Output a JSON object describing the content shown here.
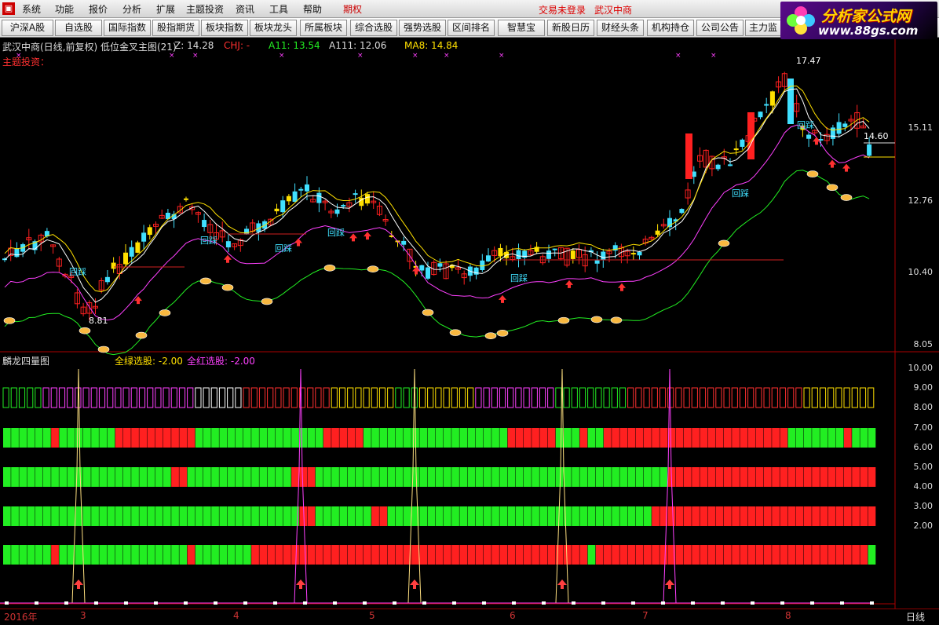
{
  "menu": {
    "items": [
      "系统",
      "功能",
      "报价",
      "分析",
      "扩展",
      "主题投资",
      "资讯",
      "工具",
      "帮助"
    ],
    "highlight": "期权",
    "status_login": "交易未登录",
    "status_stock": "武汉中商"
  },
  "toolbar": {
    "buttons": [
      "沪深A股",
      "自选股",
      "国际指数",
      "股指期货",
      "板块指数",
      "板块龙头",
      "所属板块",
      "综合选股",
      "强势选股",
      "区间排名",
      "智慧宝",
      "新股日历",
      "财经头条",
      "机构持仓",
      "公司公告",
      "主力监控"
    ]
  },
  "brand": {
    "title": "分析家公式网",
    "url": "www.88gs.com"
  },
  "main_chart": {
    "title": "武汉中商(日线,前复权) 低位金叉主图(21)",
    "z_label": "Z: 14.28",
    "chj_label": "CHJ: -",
    "a11_label": "A11: 13.54",
    "a111_label": "A111: 12.06",
    "ma8_label": "MA8: 14.84",
    "subtitle": "主题投资：",
    "price_axis": [
      "15.11",
      "12.76",
      "10.40",
      "8.05"
    ],
    "high_marker": "17.47",
    "low_marker": "8.81",
    "last_price_marker": "14.60",
    "annotation": "回踩"
  },
  "sub_chart": {
    "title": "麟龙四量图",
    "green_label": "全绿选股: -2.00",
    "red_label": "全红选股: -2.00",
    "axis": [
      "10.00",
      "9.00",
      "8.00",
      "7.00",
      "6.00",
      "5.00",
      "4.00",
      "3.00",
      "2.00"
    ]
  },
  "bottom": {
    "year": "2016年",
    "months": [
      "3",
      "4",
      "5",
      "6",
      "7",
      "8"
    ],
    "period": "日线"
  },
  "colors": {
    "up": "#ff2020",
    "down": "#40e0ff",
    "yellow": "#ffe000",
    "green": "#22ee22",
    "magenta": "#ff40ff",
    "white": "#ffffff"
  }
}
